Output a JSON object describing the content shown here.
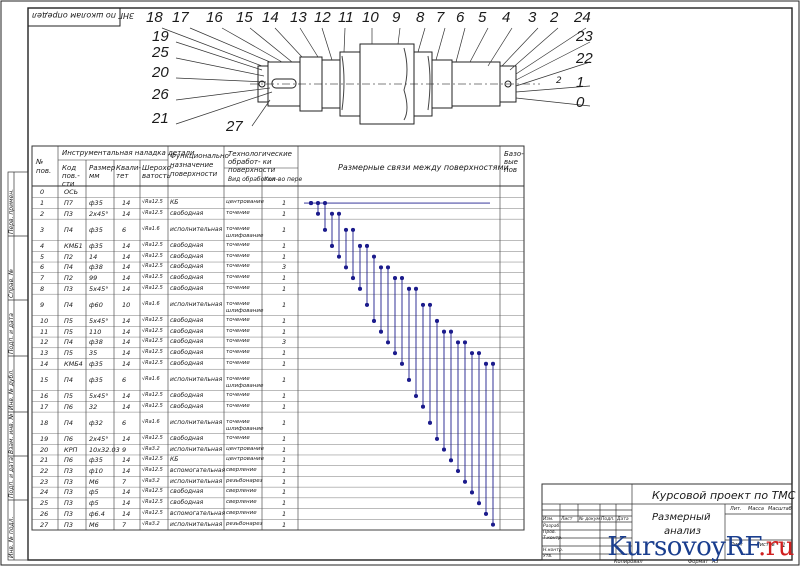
{
  "corner_label": "ЗНГ по школам определ",
  "callouts_top": [
    "18",
    "17",
    "16",
    "15",
    "14",
    "13",
    "12",
    "11",
    "10",
    "9",
    "8",
    "7",
    "6",
    "5",
    "4",
    "3",
    "2",
    "24"
  ],
  "callouts_left": [
    "19",
    "25",
    "20",
    "26",
    "21"
  ],
  "callouts_right": [
    "23",
    "22",
    "1",
    "0"
  ],
  "callout_bottom": "27",
  "datum_mark": "2",
  "table": {
    "headers": {
      "num": "№ пов.",
      "tooling_group": "Инструментальная наладка детали",
      "code": "Код пов.-сти",
      "size": "Размер мм",
      "qual": "Квали- тет",
      "rough": "Шерохо- ватость",
      "func": "Функционально назначение поверхности",
      "tech_group": "Технологические обработ- ки поверхности",
      "method": "Вид обработки",
      "count": "Кол-во пере",
      "chains": "Размерные связи между поверхностями",
      "bases": "Базо- вые пов"
    },
    "rows": [
      {
        "n": "0",
        "code": "ОСЬ",
        "size": "",
        "q": "",
        "r": "",
        "f": "",
        "m": "",
        "c": ""
      },
      {
        "n": "1",
        "code": "П7",
        "size": "ф35",
        "q": "14",
        "r": "√Ra12.5",
        "f": "КБ",
        "m": "центрование",
        "c": "1"
      },
      {
        "n": "2",
        "code": "П3",
        "size": "2х45°",
        "q": "14",
        "r": "√Ra12.5",
        "f": "свободная",
        "m": "точение",
        "c": "1"
      },
      {
        "n": "3",
        "code": "П4",
        "size": "ф35",
        "q": "6",
        "r": "√Ra1.6",
        "f": "исполнительная",
        "m": "точение шлифование",
        "c": "1"
      },
      {
        "n": "4",
        "code": "КМБ1",
        "size": "ф35",
        "q": "14",
        "r": "√Ra12.5",
        "f": "свободная",
        "m": "точение",
        "c": "1"
      },
      {
        "n": "5",
        "code": "П2",
        "size": "14",
        "q": "14",
        "r": "√Ra12.5",
        "f": "свободная",
        "m": "точение",
        "c": "1"
      },
      {
        "n": "6",
        "code": "П4",
        "size": "ф38",
        "q": "14",
        "r": "√Ra12.5",
        "f": "свободная",
        "m": "точение",
        "c": "3"
      },
      {
        "n": "7",
        "code": "П2",
        "size": "99",
        "q": "14",
        "r": "√Ra12.5",
        "f": "свободная",
        "m": "точение",
        "c": "1"
      },
      {
        "n": "8",
        "code": "П3",
        "size": "5х45°",
        "q": "14",
        "r": "√Ra12.5",
        "f": "свободная",
        "m": "точение",
        "c": "1"
      },
      {
        "n": "9",
        "code": "П4",
        "size": "ф60",
        "q": "10",
        "r": "√Ra1.6",
        "f": "исполнительная",
        "m": "точение шлифование",
        "c": "1"
      },
      {
        "n": "10",
        "code": "П5",
        "size": "5х45°",
        "q": "14",
        "r": "√Ra12.5",
        "f": "свободная",
        "m": "точение",
        "c": "1"
      },
      {
        "n": "11",
        "code": "П5",
        "size": "110",
        "q": "14",
        "r": "√Ra12.5",
        "f": "свободная",
        "m": "точение",
        "c": "1"
      },
      {
        "n": "12",
        "code": "П4",
        "size": "ф38",
        "q": "14",
        "r": "√Ra12.5",
        "f": "свободная",
        "m": "точение",
        "c": "3"
      },
      {
        "n": "13",
        "code": "П5",
        "size": "35",
        "q": "14",
        "r": "√Ra12.5",
        "f": "свободная",
        "m": "точение",
        "c": "1"
      },
      {
        "n": "14",
        "code": "КМБ4",
        "size": "ф35",
        "q": "14",
        "r": "√Ra12.5",
        "f": "свободная",
        "m": "точение",
        "c": "1"
      },
      {
        "n": "15",
        "code": "П4",
        "size": "ф35",
        "q": "6",
        "r": "√Ra1.6",
        "f": "исполнительная",
        "m": "точение шлифование",
        "c": "1"
      },
      {
        "n": "16",
        "code": "П5",
        "size": "5х45°",
        "q": "14",
        "r": "√Ra12.5",
        "f": "свободная",
        "m": "точение",
        "c": "1"
      },
      {
        "n": "17",
        "code": "П6",
        "size": "32",
        "q": "14",
        "r": "√Ra12.5",
        "f": "свободная",
        "m": "точение",
        "c": "1"
      },
      {
        "n": "18",
        "code": "П4",
        "size": "ф32",
        "q": "6",
        "r": "√Ra1.6",
        "f": "исполнительная",
        "m": "точение шлифование",
        "c": "1"
      },
      {
        "n": "19",
        "code": "П6",
        "size": "2х45°",
        "q": "14",
        "r": "√Ra12.5",
        "f": "свободная",
        "m": "точение",
        "c": "1"
      },
      {
        "n": "20",
        "code": "КРП",
        "size": "10х32.03",
        "q": "9",
        "r": "√Ra3.2",
        "f": "исполнительная",
        "m": "центрование",
        "c": "1"
      },
      {
        "n": "21",
        "code": "П6",
        "size": "ф35",
        "q": "14",
        "r": "√Ra12.5",
        "f": "КБ",
        "m": "центрование",
        "c": "1"
      },
      {
        "n": "22",
        "code": "П3",
        "size": "ф10",
        "q": "14",
        "r": "√Ra12.5",
        "f": "вспомогательная",
        "m": "сверление",
        "c": "1"
      },
      {
        "n": "23",
        "code": "П3",
        "size": "М6",
        "q": "7",
        "r": "√Ra3.2",
        "f": "исполнительная",
        "m": "резьбонарез",
        "c": "1"
      },
      {
        "n": "24",
        "code": "П3",
        "size": "ф5",
        "q": "14",
        "r": "√Ra12.5",
        "f": "свободная",
        "m": "сверление",
        "c": "1"
      },
      {
        "n": "25",
        "code": "П3",
        "size": "ф5",
        "q": "14",
        "r": "√Ra12.5",
        "f": "свободная",
        "m": "сверление",
        "c": "1"
      },
      {
        "n": "26",
        "code": "П3",
        "size": "ф6.4",
        "q": "14",
        "r": "√Ra12.5",
        "f": "вспомогательная",
        "m": "сверление",
        "c": "1"
      },
      {
        "n": "27",
        "code": "П3",
        "size": "М6",
        "q": "7",
        "r": "√Ra3.2",
        "f": "исполнительная",
        "m": "резьбонарез",
        "c": "1"
      }
    ]
  },
  "side_labels": [
    "Перв. примен.",
    "Справ. №",
    "Подп. и дата",
    "Инв. № дубл.",
    "Взам. инв. №",
    "Подп. и дата",
    "Инв. № подл."
  ],
  "stamp": {
    "title": "Курсовой проект по ТМС",
    "doc_name_line1": "Размерный",
    "doc_name_line2": "анализ",
    "lit": "Лит.",
    "mass": "Масса",
    "scale": "Масштаб",
    "sheet": "Лист",
    "sheets": "Листов",
    "sheets_count": "1",
    "rows_left": [
      "Изм.",
      "Лист",
      "№ докум.",
      "Подп.",
      "Дата"
    ],
    "roles": [
      "Разраб.",
      "Пров.",
      "Т.контр.",
      "",
      "Н.контр.",
      "Утв."
    ],
    "copied": "Копировал",
    "format": "Формат",
    "format_value": "А3"
  },
  "watermark": {
    "main": "KursovoyRF",
    "accent": ".ru"
  }
}
